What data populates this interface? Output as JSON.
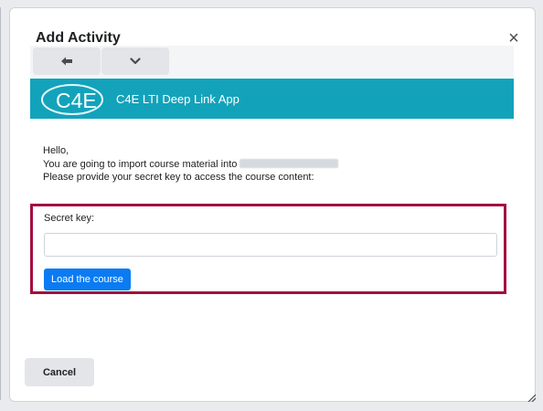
{
  "dialog": {
    "title": "Add Activity",
    "close_symbol": "×"
  },
  "nav": {
    "back_icon": "arrow-left-icon",
    "down_icon": "chevron-down-icon"
  },
  "app": {
    "logo_text": "C4E",
    "title": "C4E LTI Deep Link App",
    "brand_color": "#12a3bb"
  },
  "content": {
    "hello": "Hello,",
    "import_text": "You are going to import course material into",
    "instruction": "Please provide your secret key to access the course content:"
  },
  "form": {
    "secret_label": "Secret key:",
    "secret_value": "",
    "load_button": "Load the course",
    "highlight_color": "#a30d3e"
  },
  "footer": {
    "cancel_button": "Cancel"
  }
}
